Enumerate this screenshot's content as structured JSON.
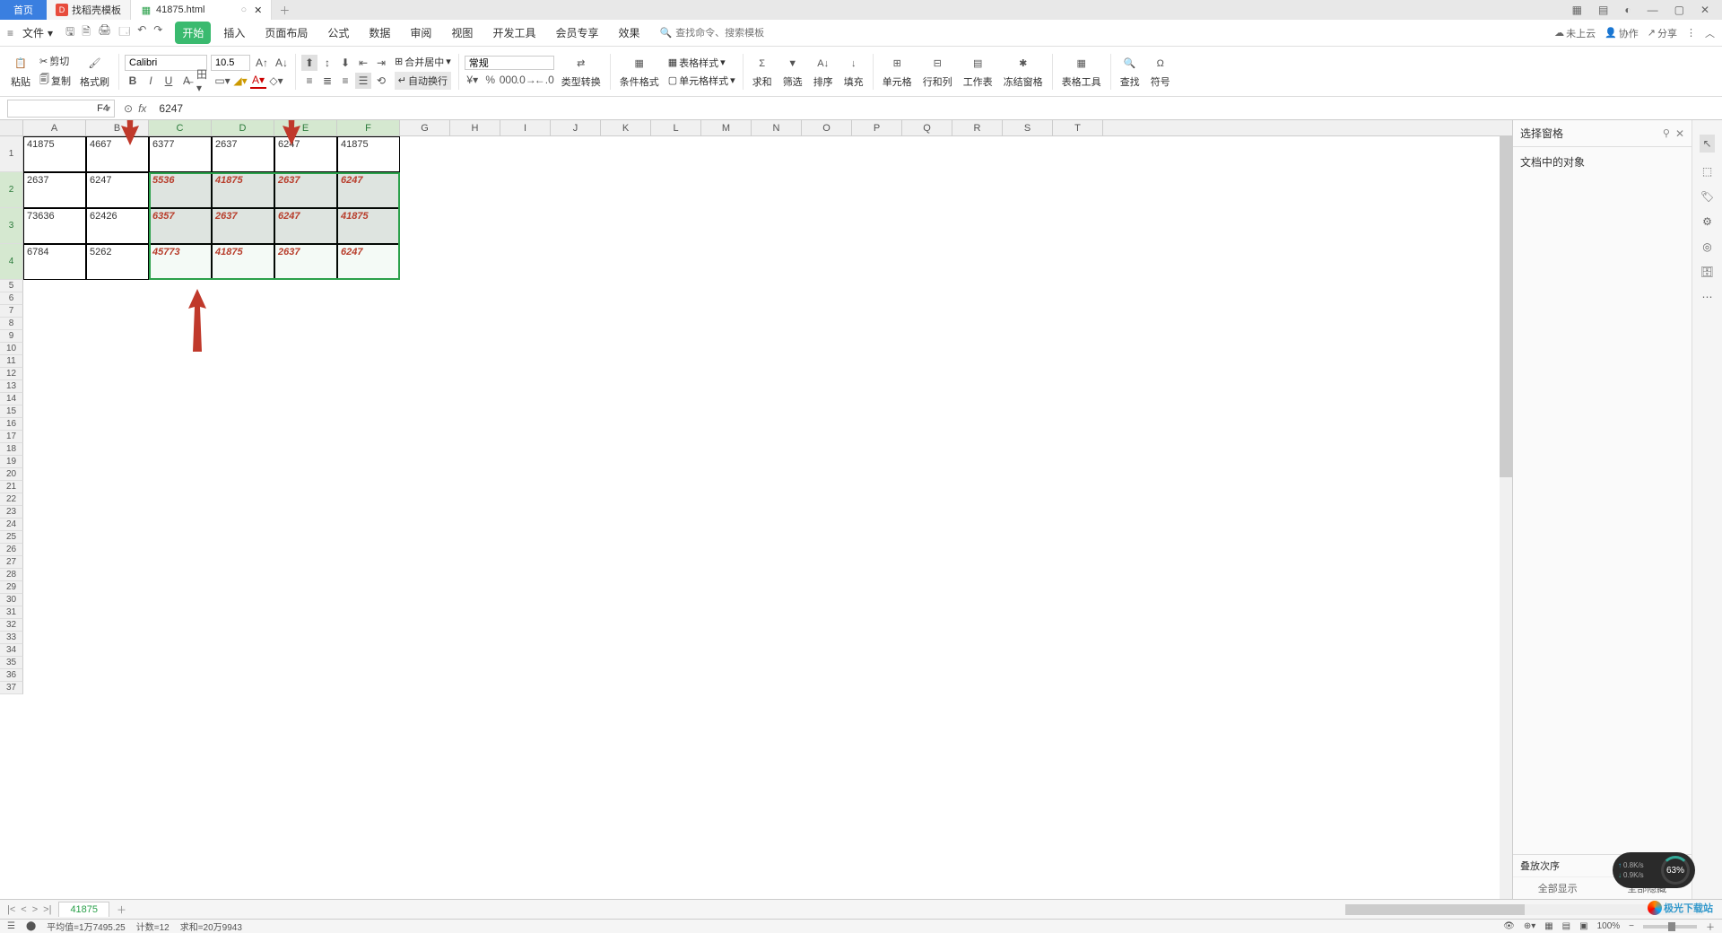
{
  "titlebar": {
    "home": "首页",
    "tab1": "找稻壳模板",
    "tab2": "41875.html",
    "newtab": "＋"
  },
  "wincontrols": {
    "grid": "▦",
    "app": "▤",
    "user": "◐",
    "min": "—",
    "max": "▢",
    "close": "✕"
  },
  "menubar": {
    "file": "文件",
    "filedd": "▾",
    "qat": {
      "save": "🖫",
      "saveas": "🗎",
      "print": "🖨",
      "preview": "🗔",
      "undo": "↶",
      "redo": "↷"
    },
    "tabs": {
      "start": "开始",
      "insert": "插入",
      "layout": "页面布局",
      "formula": "公式",
      "data": "数据",
      "review": "审阅",
      "view": "视图",
      "dev": "开发工具",
      "member": "会员专享",
      "effect": "效果"
    },
    "search_placeholder": "查找命令、搜索模板",
    "right": {
      "cloud": "未上云",
      "collab": "协作",
      "share": "分享"
    }
  },
  "ribbon": {
    "paste": "粘贴",
    "cut": "剪切",
    "copy": "复制",
    "fmtpaint": "格式刷",
    "font": "Calibri",
    "size": "10.5",
    "merge": "合并居中",
    "wrap": "自动换行",
    "numfmt": "常规",
    "typeconv": "类型转换",
    "condfmt": "条件格式",
    "tablefmt": "表格样式",
    "cellfmt": "单元格样式",
    "sum": "求和",
    "filter": "筛选",
    "sort": "排序",
    "fill": "填充",
    "cells": "单元格",
    "rowcol": "行和列",
    "sheet": "工作表",
    "freeze": "冻结窗格",
    "tabletool": "表格工具",
    "find": "查找",
    "symbol": "符号"
  },
  "formulabar": {
    "cell": "F4",
    "fx": "fx",
    "value": "6247"
  },
  "columns": [
    "A",
    "B",
    "C",
    "D",
    "E",
    "F",
    "G",
    "H",
    "I",
    "J",
    "K",
    "L",
    "M",
    "N",
    "O",
    "P",
    "Q",
    "R",
    "S",
    "T"
  ],
  "rownums": [
    1,
    2,
    3,
    4,
    5,
    6,
    7,
    8,
    9,
    10,
    11,
    12,
    13,
    14,
    15,
    16,
    17,
    18,
    19,
    20,
    21,
    22,
    23,
    24,
    25,
    26,
    27,
    28,
    29,
    30,
    31,
    32,
    33,
    34,
    35,
    36,
    37
  ],
  "cells": {
    "r1": {
      "A": "41875",
      "B": "4667",
      "C": "6377",
      "D": "2637",
      "E": "6247",
      "F": "41875"
    },
    "r2": {
      "A": "2637",
      "B": "6247",
      "C": "5536",
      "D": "41875",
      "E": "2637",
      "F": "6247"
    },
    "r3": {
      "A": "73636",
      "B": "62426",
      "C": "6357",
      "D": "2637",
      "E": "6247",
      "F": "41875"
    },
    "r4": {
      "A": "6784",
      "B": "5262",
      "C": "45773",
      "D": "41875",
      "E": "2637",
      "F": "6247"
    }
  },
  "rightpanel": {
    "title": "选择窗格",
    "body": "文档中的对象",
    "stack": "叠放次序",
    "showall": "全部显示",
    "hideall": "全部隐藏"
  },
  "sheettab": {
    "name": "41875"
  },
  "statusbar": {
    "avg": "平均值=1万7495.25",
    "count": "计数=12",
    "sum": "求和=20万9943",
    "zoom": "100%"
  },
  "speed": {
    "up": "0.8K/s",
    "down": "0.9K/s",
    "ring": "63%"
  },
  "watermark": "极光下载站"
}
